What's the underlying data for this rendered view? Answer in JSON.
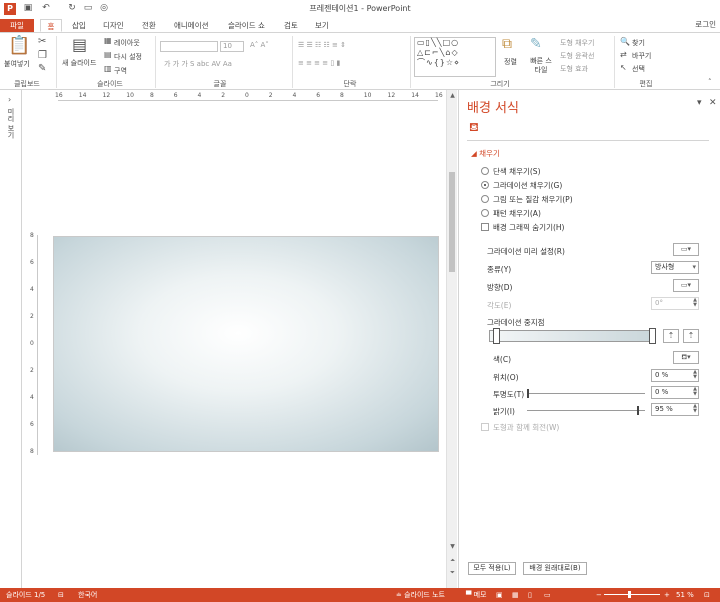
{
  "window": {
    "title": "프레젠테이션1 - PowerPoint",
    "app_icon": "P"
  },
  "tabs": [
    {
      "label": "파일"
    },
    {
      "label": "홈"
    },
    {
      "label": "삽입"
    },
    {
      "label": "디자인"
    },
    {
      "label": "전환"
    },
    {
      "label": "애니메이션"
    },
    {
      "label": "슬라이드 쇼"
    },
    {
      "label": "검토"
    },
    {
      "label": "보기"
    }
  ],
  "login": "로그인",
  "ribbon": {
    "groups": [
      "클립보드",
      "슬라이드",
      "글꼴",
      "단락",
      "그리기",
      "편집"
    ],
    "paste": "붙여넣기",
    "new_slide": "새 슬라이드",
    "layout": "레이아웃",
    "reset": "다시 설정",
    "section": "구역",
    "font_size": "10",
    "arrange": "정렬",
    "quick_styles": "빠른 스타일",
    "shape_fill": "도형 채우기",
    "shape_outline": "도형 윤곽선",
    "shape_effects": "도형 효과",
    "find": "찾기",
    "replace": "바꾸기",
    "select": "선택"
  },
  "thumbs_label": "미리 보기",
  "ruler": {
    "h_labels": [
      "16",
      "14",
      "12",
      "10",
      "8",
      "6",
      "4",
      "2",
      "0",
      "2",
      "4",
      "6",
      "8",
      "10",
      "12",
      "14",
      "16"
    ],
    "v_labels": [
      "8",
      "6",
      "4",
      "2",
      "0",
      "2",
      "4",
      "6",
      "8"
    ]
  },
  "pane": {
    "title": "배경 서식",
    "section": "채우기",
    "fill_options": [
      {
        "label": "단색 채우기(S)",
        "selected": false
      },
      {
        "label": "그라데이션 채우기(G)",
        "selected": true
      },
      {
        "label": "그림 또는 질감 채우기(P)",
        "selected": false
      },
      {
        "label": "패턴 채우기(A)",
        "selected": false
      }
    ],
    "hide_graphics": "배경 그래픽 숨기기(H)",
    "preset_label": "그라데이션 미리 설정(R)",
    "type_label": "종류(Y)",
    "type_value": "방사형",
    "direction_label": "방향(D)",
    "angle_label": "각도(E)",
    "angle_value": "0°",
    "stops_label": "그라데이션 중지점",
    "color_label": "색(C)",
    "position_label": "위치(O)",
    "position_value": "0 %",
    "transparency_label": "투명도(T)",
    "transparency_value": "0 %",
    "brightness_label": "밝기(I)",
    "brightness_value": "95 %",
    "rotate_with_shape": "도형과 함께 회전(W)",
    "apply_all": "모두 적용(L)",
    "reset_bg": "배경 원래대로(B)",
    "transparency_level": 0,
    "brightness_level": 0.95
  },
  "status": {
    "slide": "슬라이드 1/5",
    "language": "한국어",
    "notes": "슬라이드 노트",
    "comments": "메모",
    "zoom": "51 %"
  },
  "colors": {
    "accent": "#d24726"
  }
}
